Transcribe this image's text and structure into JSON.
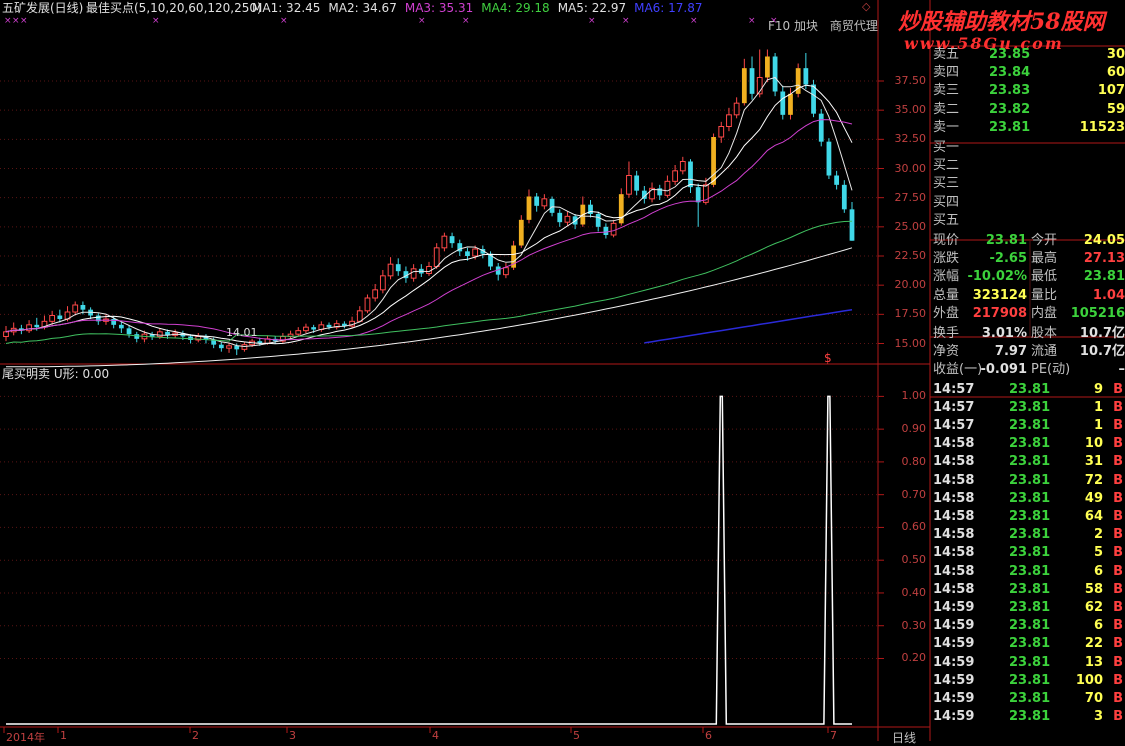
{
  "header": {
    "stock": "五矿发展(日线)",
    "indicator": "最佳买点(5,10,20,60,120,250)",
    "ma": [
      {
        "label": "MA1: 32.45",
        "color": "#e0e0e0"
      },
      {
        "label": "MA2: 34.67",
        "color": "#e0e0e0"
      },
      {
        "label": "MA3: 35.31",
        "color": "#d040d0"
      },
      {
        "label": "MA4: 29.18",
        "color": "#40d040"
      },
      {
        "label": "MA5: 22.97",
        "color": "#e0e0e0"
      },
      {
        "label": "MA6: 17.87",
        "color": "#4040ff"
      }
    ]
  },
  "top_right_tabs": [
    "F10",
    "加块",
    "商贸代理"
  ],
  "watermark": {
    "title": "炒股辅助教材58股网",
    "url": "www.58Gu.com"
  },
  "indicator_panel": {
    "title": "尾买明卖 U形: 0.00"
  },
  "price_axis": [
    "37.50",
    "35.00",
    "32.50",
    "30.00",
    "27.50",
    "25.00",
    "22.50",
    "20.00",
    "17.50",
    "15.00"
  ],
  "indicator_axis": [
    "1.00",
    "0.90",
    "0.80",
    "0.70",
    "0.60",
    "0.50",
    "0.40",
    "0.30",
    "0.20"
  ],
  "bottom_axis": {
    "labels": [
      "2014年",
      "1",
      "2",
      "3",
      "4",
      "5",
      "6",
      "7"
    ],
    "period": "日线"
  },
  "annotations": {
    "low_price": "14.01",
    "dollar": "$"
  },
  "chart_data": [
    {
      "type": "candlestick",
      "title": "五矿发展(日线)",
      "ylim": [
        13.5,
        40.5
      ],
      "note": "approximate daily candles (open, close, high, low)",
      "candles": [
        [
          15.6,
          16.0,
          16.5,
          15.2
        ],
        [
          16.0,
          16.3,
          16.8,
          15.7
        ],
        [
          16.3,
          16.1,
          16.6,
          15.8
        ],
        [
          16.1,
          16.6,
          17.0,
          15.9
        ],
        [
          16.6,
          16.4,
          17.2,
          16.1
        ],
        [
          16.4,
          16.9,
          17.4,
          16.2
        ],
        [
          16.9,
          17.4,
          17.8,
          16.6
        ],
        [
          17.4,
          17.1,
          17.9,
          16.8
        ],
        [
          17.1,
          17.7,
          18.2,
          16.9
        ],
        [
          17.7,
          18.3,
          18.6,
          17.4
        ],
        [
          18.3,
          17.9,
          18.6,
          17.5
        ],
        [
          17.9,
          17.4,
          18.1,
          17.1
        ],
        [
          17.4,
          16.9,
          17.6,
          16.6
        ],
        [
          16.9,
          17.1,
          17.5,
          16.6
        ],
        [
          17.1,
          16.6,
          17.3,
          16.3
        ],
        [
          16.6,
          16.3,
          16.9,
          15.9
        ],
        [
          16.3,
          15.8,
          16.5,
          15.5
        ],
        [
          15.8,
          15.4,
          16.0,
          15.1
        ],
        [
          15.4,
          15.8,
          16.1,
          15.1
        ],
        [
          15.8,
          15.6,
          16.0,
          15.3
        ],
        [
          15.6,
          16.0,
          16.3,
          15.4
        ],
        [
          16.0,
          15.7,
          16.2,
          15.4
        ],
        [
          15.7,
          15.9,
          16.2,
          15.5
        ],
        [
          15.9,
          15.6,
          16.1,
          15.3
        ],
        [
          15.6,
          15.3,
          15.8,
          15.0
        ],
        [
          15.3,
          15.6,
          15.9,
          15.1
        ],
        [
          15.6,
          15.3,
          15.8,
          15.0
        ],
        [
          15.3,
          14.9,
          15.5,
          14.6
        ],
        [
          14.9,
          14.6,
          15.1,
          14.3
        ],
        [
          14.6,
          14.8,
          15.0,
          14.2
        ],
        [
          14.8,
          14.5,
          15.0,
          14.01
        ],
        [
          14.5,
          14.9,
          15.1,
          14.3
        ],
        [
          14.9,
          15.2,
          15.4,
          14.7
        ],
        [
          15.2,
          15.0,
          15.5,
          14.8
        ],
        [
          15.0,
          15.4,
          15.7,
          14.9
        ],
        [
          15.4,
          15.2,
          15.6,
          15.0
        ],
        [
          15.2,
          15.6,
          15.9,
          15.0
        ],
        [
          15.6,
          15.8,
          16.1,
          15.4
        ],
        [
          15.8,
          16.1,
          16.4,
          15.6
        ],
        [
          16.1,
          16.4,
          16.7,
          15.9
        ],
        [
          16.4,
          16.2,
          16.6,
          15.9
        ],
        [
          16.2,
          16.6,
          16.9,
          16.0
        ],
        [
          16.6,
          16.4,
          16.8,
          16.2
        ],
        [
          16.4,
          16.7,
          17.0,
          16.2
        ],
        [
          16.7,
          16.5,
          16.9,
          16.3
        ],
        [
          16.5,
          16.9,
          17.3,
          16.3
        ],
        [
          16.9,
          17.8,
          18.2,
          16.8
        ],
        [
          17.8,
          18.9,
          19.2,
          17.6
        ],
        [
          18.9,
          19.6,
          20.1,
          18.6
        ],
        [
          19.6,
          20.8,
          21.3,
          19.3
        ],
        [
          20.8,
          21.8,
          22.4,
          20.5
        ],
        [
          21.8,
          21.2,
          22.3,
          20.8
        ],
        [
          21.2,
          20.6,
          21.6,
          20.2
        ],
        [
          20.6,
          21.4,
          21.8,
          20.3
        ],
        [
          21.4,
          21.0,
          21.8,
          20.7
        ],
        [
          21.0,
          21.6,
          22.0,
          20.8
        ],
        [
          21.6,
          23.2,
          23.6,
          21.4
        ],
        [
          23.2,
          24.2,
          24.5,
          22.9
        ],
        [
          24.2,
          23.6,
          24.5,
          23.2
        ],
        [
          23.6,
          22.9,
          23.9,
          22.5
        ],
        [
          22.9,
          22.5,
          23.2,
          22.1
        ],
        [
          22.5,
          23.1,
          23.4,
          22.2
        ],
        [
          23.1,
          22.7,
          23.4,
          22.3
        ],
        [
          22.7,
          21.6,
          22.9,
          21.3
        ],
        [
          21.6,
          20.9,
          21.9,
          20.4
        ],
        [
          20.9,
          21.5,
          21.9,
          20.6
        ],
        [
          21.5,
          23.4,
          23.8,
          21.3
        ],
        [
          23.4,
          25.6,
          26.0,
          23.2
        ],
        [
          25.6,
          27.6,
          28.2,
          25.3
        ],
        [
          27.6,
          26.8,
          27.9,
          26.3
        ],
        [
          26.8,
          27.4,
          27.8,
          26.5
        ],
        [
          27.4,
          26.2,
          27.6,
          25.9
        ],
        [
          26.2,
          25.4,
          26.5,
          25.0
        ],
        [
          25.4,
          25.9,
          26.3,
          25.1
        ],
        [
          25.9,
          25.2,
          26.1,
          24.8
        ],
        [
          25.2,
          26.9,
          27.6,
          25.0
        ],
        [
          26.9,
          26.1,
          27.3,
          25.8
        ],
        [
          26.1,
          25.0,
          26.3,
          24.6
        ],
        [
          25.0,
          24.3,
          25.3,
          24.0
        ],
        [
          24.3,
          25.3,
          25.6,
          24.1
        ],
        [
          25.3,
          27.8,
          28.3,
          25.1
        ],
        [
          27.8,
          29.4,
          30.6,
          27.5
        ],
        [
          29.4,
          28.1,
          29.8,
          27.7
        ],
        [
          28.1,
          27.4,
          28.5,
          27.0
        ],
        [
          27.4,
          28.3,
          28.8,
          27.1
        ],
        [
          28.3,
          27.7,
          28.6,
          27.3
        ],
        [
          27.7,
          28.9,
          29.4,
          27.5
        ],
        [
          28.9,
          29.8,
          30.3,
          28.6
        ],
        [
          29.8,
          30.6,
          31.0,
          29.5
        ],
        [
          30.6,
          28.4,
          30.8,
          27.9
        ],
        [
          28.4,
          27.1,
          28.7,
          25.0
        ],
        [
          27.1,
          28.6,
          29.2,
          26.9
        ],
        [
          28.6,
          32.7,
          33.0,
          28.4
        ],
        [
          32.7,
          33.6,
          34.0,
          32.2
        ],
        [
          33.6,
          34.6,
          35.2,
          33.2
        ],
        [
          34.6,
          35.6,
          36.1,
          34.3
        ],
        [
          35.6,
          38.6,
          39.4,
          35.4
        ],
        [
          38.6,
          36.4,
          39.6,
          35.9
        ],
        [
          36.4,
          37.8,
          40.2,
          36.1
        ],
        [
          37.8,
          39.6,
          40.2,
          37.4
        ],
        [
          39.6,
          36.6,
          39.9,
          36.2
        ],
        [
          36.6,
          34.6,
          37.1,
          34.2
        ],
        [
          34.6,
          36.4,
          36.9,
          34.2
        ],
        [
          36.4,
          38.6,
          39.0,
          36.1
        ],
        [
          38.6,
          37.2,
          39.9,
          36.8
        ],
        [
          37.2,
          34.7,
          37.6,
          34.4
        ],
        [
          34.7,
          32.3,
          35.1,
          31.9
        ],
        [
          32.3,
          29.4,
          32.6,
          29.1
        ],
        [
          29.4,
          28.6,
          29.8,
          28.2
        ],
        [
          28.6,
          26.5,
          29.0,
          26.2
        ],
        [
          26.5,
          23.81,
          27.13,
          23.81
        ]
      ],
      "moving_averages": [
        {
          "name": "MA1",
          "period": 5,
          "color": "#e0e0e0"
        },
        {
          "name": "MA2",
          "period": 10,
          "color": "#ffffff"
        },
        {
          "name": "MA3",
          "period": 20,
          "color": "#d040d0"
        },
        {
          "name": "MA4",
          "period": 60,
          "color": "#40c060"
        },
        {
          "name": "MA5",
          "period": 120,
          "color": "#f0f0f0"
        },
        {
          "name": "MA6",
          "period": 250,
          "color": "#2020d0"
        }
      ]
    },
    {
      "type": "line",
      "title": "尾买明卖 U形",
      "ylim": [
        0,
        1.05
      ],
      "spikes": [
        {
          "bar": 93,
          "value": 1.0
        },
        {
          "bar": 107,
          "value": 1.0
        }
      ]
    }
  ],
  "quote": {
    "asks": [
      {
        "label": "卖五",
        "price": "23.85",
        "vol": "30",
        "price_color": "g"
      },
      {
        "label": "卖四",
        "price": "23.84",
        "vol": "60",
        "price_color": "g"
      },
      {
        "label": "卖三",
        "price": "23.83",
        "vol": "107",
        "price_color": "g"
      },
      {
        "label": "卖二",
        "price": "23.82",
        "vol": "59",
        "price_color": "g"
      },
      {
        "label": "卖一",
        "price": "23.81",
        "vol": "11523",
        "price_color": "g"
      }
    ],
    "bids": [
      "买一",
      "买二",
      "买三",
      "买四",
      "买五"
    ],
    "stats": [
      {
        "l1": "现价",
        "v1": "23.81",
        "c1": "g",
        "l2": "今开",
        "v2": "24.05",
        "c2": "y"
      },
      {
        "l1": "涨跌",
        "v1": "-2.65",
        "c1": "g",
        "l2": "最高",
        "v2": "27.13",
        "c2": "r"
      },
      {
        "l1": "涨幅",
        "v1": "-10.02%",
        "c1": "g",
        "l2": "最低",
        "v2": "23.81",
        "c2": "g"
      },
      {
        "l1": "总量",
        "v1": "323124",
        "c1": "y",
        "l2": "量比",
        "v2": "1.04",
        "c2": "r"
      },
      {
        "l1": "外盘",
        "v1": "217908",
        "c1": "r",
        "l2": "内盘",
        "v2": "105216",
        "c2": "g"
      }
    ],
    "fund": [
      {
        "l1": "换手",
        "v1": "3.01%",
        "l2": "股本",
        "v2": "10.7亿"
      },
      {
        "l1": "净资",
        "v1": "7.97",
        "l2": "流通",
        "v2": "10.7亿"
      },
      {
        "l1": "收益(一)",
        "v1": "-0.091",
        "l2": "PE(动)",
        "v2": "–"
      }
    ],
    "ticks": [
      {
        "time": "14:57",
        "price": "23.81",
        "vol": "9",
        "side": "B"
      },
      {
        "time": "14:57",
        "price": "23.81",
        "vol": "1",
        "side": "B"
      },
      {
        "time": "14:57",
        "price": "23.81",
        "vol": "1",
        "side": "B"
      },
      {
        "time": "14:58",
        "price": "23.81",
        "vol": "10",
        "side": "B"
      },
      {
        "time": "14:58",
        "price": "23.81",
        "vol": "31",
        "side": "B"
      },
      {
        "time": "14:58",
        "price": "23.81",
        "vol": "72",
        "side": "B"
      },
      {
        "time": "14:58",
        "price": "23.81",
        "vol": "49",
        "side": "B"
      },
      {
        "time": "14:58",
        "price": "23.81",
        "vol": "64",
        "side": "B"
      },
      {
        "time": "14:58",
        "price": "23.81",
        "vol": "2",
        "side": "B"
      },
      {
        "time": "14:58",
        "price": "23.81",
        "vol": "5",
        "side": "B"
      },
      {
        "time": "14:58",
        "price": "23.81",
        "vol": "6",
        "side": "B"
      },
      {
        "time": "14:58",
        "price": "23.81",
        "vol": "58",
        "side": "B"
      },
      {
        "time": "14:59",
        "price": "23.81",
        "vol": "62",
        "side": "B"
      },
      {
        "time": "14:59",
        "price": "23.81",
        "vol": "6",
        "side": "B"
      },
      {
        "time": "14:59",
        "price": "23.81",
        "vol": "22",
        "side": "B"
      },
      {
        "time": "14:59",
        "price": "23.81",
        "vol": "13",
        "side": "B"
      },
      {
        "time": "14:59",
        "price": "23.81",
        "vol": "100",
        "side": "B"
      },
      {
        "time": "14:59",
        "price": "23.81",
        "vol": "70",
        "side": "B"
      },
      {
        "time": "14:59",
        "price": "23.81",
        "vol": "3",
        "side": "B"
      }
    ]
  }
}
